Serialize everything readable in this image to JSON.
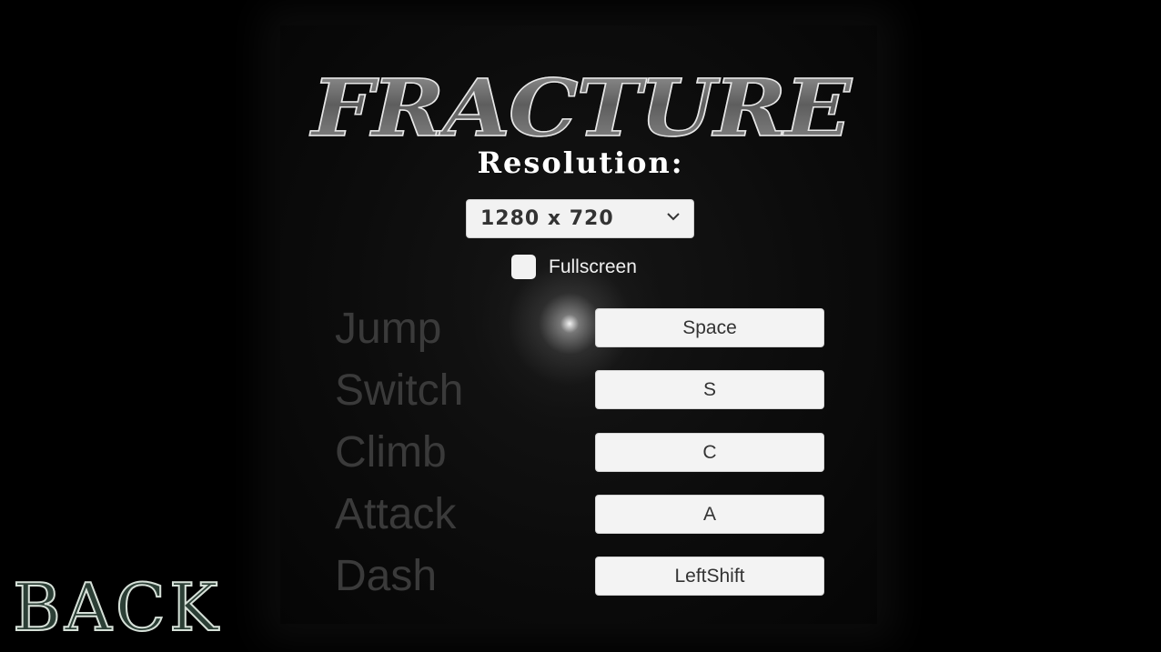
{
  "game": {
    "title": "FRACTURE"
  },
  "settings": {
    "resolution_label": "Resolution:",
    "resolution_value": "1280 x 720",
    "fullscreen_label": "Fullscreen",
    "fullscreen_checked": false
  },
  "controls": [
    {
      "action": "Jump",
      "key": "Space"
    },
    {
      "action": "Switch",
      "key": "S"
    },
    {
      "action": "Climb",
      "key": "C"
    },
    {
      "action": "Attack",
      "key": "A"
    },
    {
      "action": "Dash",
      "key": "LeftShift"
    }
  ],
  "nav": {
    "back_label": "BACK"
  },
  "icons": {
    "dropdown": "chevron-down-icon",
    "checkbox": "checkbox-icon"
  },
  "colors": {
    "background": "#000000",
    "button": "#f3f3f3",
    "action_text": "#3a3a3a",
    "back_fill": "#2c3f36",
    "back_stroke": "#d6e0d8"
  }
}
